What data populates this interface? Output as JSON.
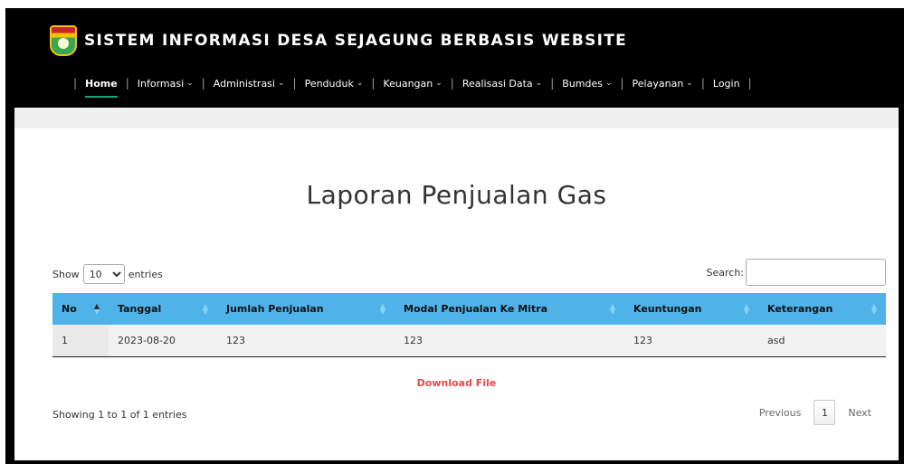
{
  "header": {
    "site_title": "SISTEM INFORMASI DESA SEJAGUNG BERBASIS WEBSITE",
    "nav": [
      {
        "label": "Home",
        "active": true,
        "dropdown": false
      },
      {
        "label": "Informasi",
        "active": false,
        "dropdown": true
      },
      {
        "label": "Administrasi",
        "active": false,
        "dropdown": true
      },
      {
        "label": "Penduduk",
        "active": false,
        "dropdown": true
      },
      {
        "label": "Keuangan",
        "active": false,
        "dropdown": true
      },
      {
        "label": "Realisasi Data",
        "active": false,
        "dropdown": true
      },
      {
        "label": "Bumdes",
        "active": false,
        "dropdown": true
      },
      {
        "label": "Pelayanan",
        "active": false,
        "dropdown": true
      },
      {
        "label": "Login",
        "active": false,
        "dropdown": false
      }
    ]
  },
  "page": {
    "title": "Laporan Penjualan Gas"
  },
  "table_controls": {
    "show_label": "Show",
    "entries_label": "entries",
    "length_value": "10",
    "search_label": "Search:",
    "search_value": ""
  },
  "table": {
    "columns": [
      "No",
      "Tanggal",
      "Jumlah Penjualan",
      "Modal Penjualan Ke Mitra",
      "Keuntungan",
      "Keterangan"
    ],
    "rows": [
      [
        "1",
        "2023-08-20",
        "123",
        "123",
        "123",
        "asd"
      ]
    ]
  },
  "download_label": "Download File",
  "footer": {
    "info": "Showing 1 to 1 of 1 entries",
    "previous": "Previous",
    "page": "1",
    "next": "Next"
  },
  "colors": {
    "header_bg": "#000000",
    "table_header_bg": "#4fb3ea",
    "active_underline": "#1aa37a",
    "download_link": "#e24b4b"
  }
}
